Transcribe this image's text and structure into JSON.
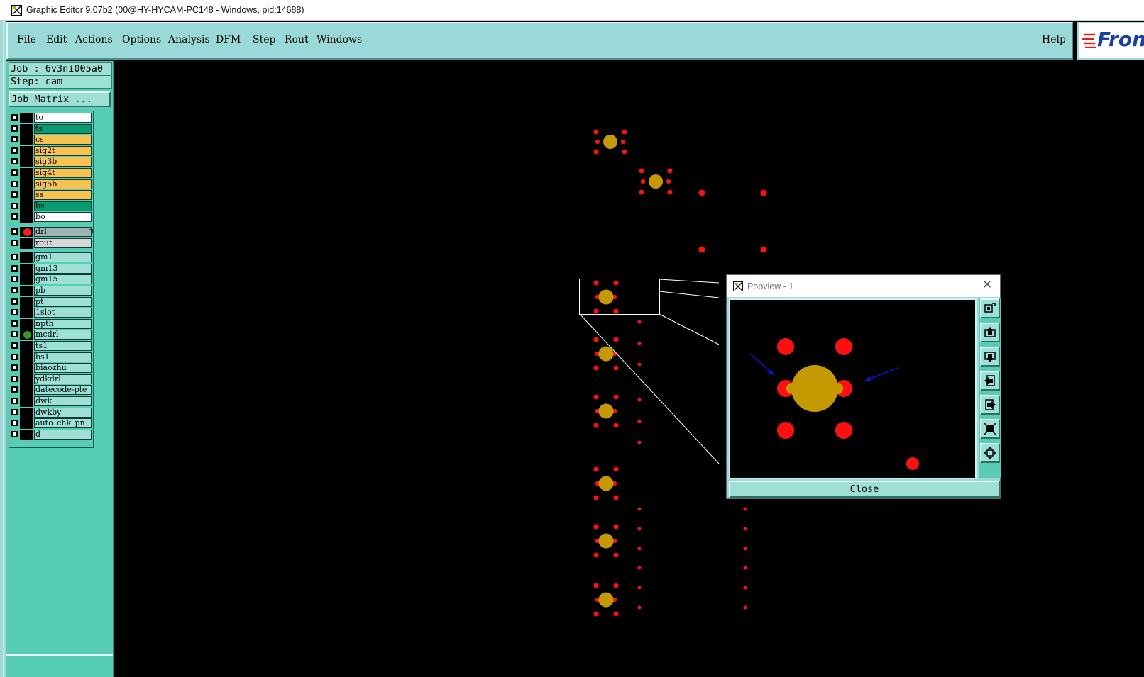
{
  "window": {
    "title": "Graphic Editor 9.07b2 (00@HY-HYCAM-PC148 - Windows, pid:14688)"
  },
  "menu": {
    "items": [
      "File",
      "Edit",
      "Actions",
      "Options",
      "Analysis",
      "DFM",
      "Step",
      "Rout",
      "Windows"
    ],
    "help": "Help"
  },
  "logo": {
    "text": "Fron"
  },
  "panel": {
    "job": "Job : 6v3ni005a0",
    "step": "Step: cam",
    "job_matrix": "Job Matrix ..."
  },
  "layers": [
    {
      "name": "to",
      "color": "#ffffff",
      "checked": false
    },
    {
      "name": "ts",
      "color": "#0a9a70",
      "checked": false
    },
    {
      "name": "cs",
      "color": "#f9c14f",
      "checked": false
    },
    {
      "name": "sig2t",
      "color": "#f9c14f",
      "checked": false
    },
    {
      "name": "sig3b",
      "color": "#f9c14f",
      "checked": false
    },
    {
      "name": "sig4t",
      "color": "#f9c14f",
      "checked": false
    },
    {
      "name": "sig5b",
      "color": "#f9c14f",
      "checked": false
    },
    {
      "name": "ss",
      "color": "#f9c14f",
      "checked": false
    },
    {
      "name": "bs",
      "color": "#0a9a70",
      "checked": false
    },
    {
      "name": "bo",
      "color": "#ffffff",
      "checked": false
    },
    {
      "name": "drl",
      "color": "#9fb3b4",
      "checked": true,
      "dot": "#ff1a1a",
      "gap": true
    },
    {
      "name": "rout",
      "color": "#d8d8d8",
      "checked": false
    },
    {
      "name": "gm1",
      "color": "#9fe0d6",
      "checked": false,
      "gap": true
    },
    {
      "name": "gm13",
      "color": "#9fe0d6",
      "checked": false
    },
    {
      "name": "gm15",
      "color": "#9fe0d6",
      "checked": false
    },
    {
      "name": "pb",
      "color": "#9fe0d6",
      "checked": false
    },
    {
      "name": "pt",
      "color": "#9fe0d6",
      "checked": false
    },
    {
      "name": "1slot",
      "color": "#9fe0d6",
      "checked": false
    },
    {
      "name": "npth",
      "color": "#9fe0d6",
      "checked": false
    },
    {
      "name": "mcdrl",
      "color": "#9fe0d6",
      "checked": false,
      "dot": "#3a9a1e"
    },
    {
      "name": "ts1",
      "color": "#9fe0d6",
      "checked": false
    },
    {
      "name": "bs1",
      "color": "#9fe0d6",
      "checked": false
    },
    {
      "name": "biaozhu",
      "color": "#9fe0d6",
      "checked": false
    },
    {
      "name": "ydkdrl",
      "color": "#9fe0d6",
      "checked": false
    },
    {
      "name": "datecode-pte",
      "color": "#9fe0d6",
      "checked": false
    },
    {
      "name": "dwk",
      "color": "#9fe0d6",
      "checked": false
    },
    {
      "name": "dwkby",
      "color": "#9fe0d6",
      "checked": false
    },
    {
      "name": "auto_chk_pn",
      "color": "#9fe0d6",
      "checked": false
    },
    {
      "name": "d",
      "color": "#9fe0d6",
      "checked": false
    }
  ],
  "popview": {
    "title": "Popview - 1",
    "close_label": "Close"
  },
  "colors": {
    "pad_red": "#ff1010",
    "pad_gold": "#c49a00",
    "arrow_blue": "#1010d0"
  }
}
